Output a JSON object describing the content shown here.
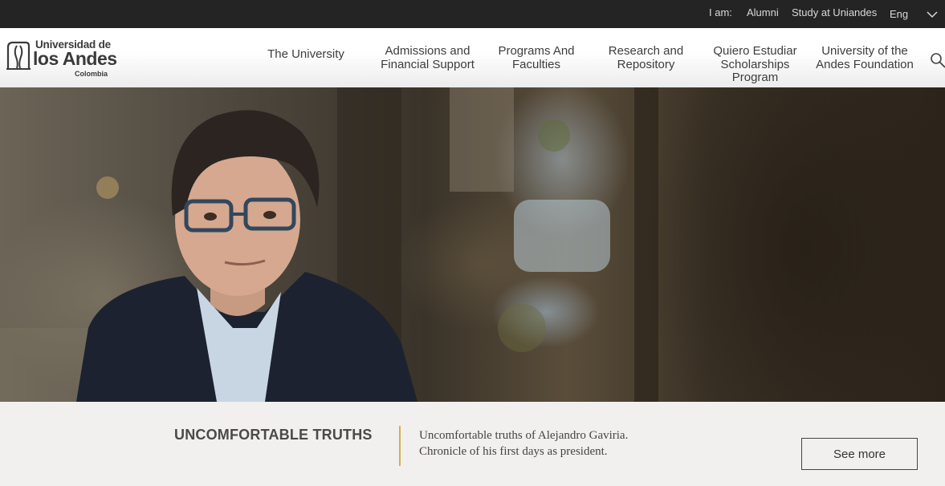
{
  "topbar": {
    "i_am_label": "I am:",
    "links": [
      "Alumni",
      "Study at Uniandes"
    ],
    "language": "Eng",
    "language_icon": "chevron-down-icon"
  },
  "logo": {
    "line1": "Universidad de",
    "line2": "los Andes",
    "line3": "Colombia"
  },
  "nav": {
    "items": [
      "The University",
      "Admissions and Financial Support",
      "Programs And Faculties",
      "Research and Repository",
      "Quiero Estudiar Scholarships Program",
      "University of the Andes Foundation"
    ],
    "search_icon": "search-icon"
  },
  "hero": {
    "image": "portrait-photo"
  },
  "feature": {
    "title": "UNCOMFORTABLE TRUTHS",
    "description_line1": "Uncomfortable truths of Alejandro Gaviria.",
    "description_line2": "Chronicle of his first days as president.",
    "button_label": "See more",
    "accent_color": "#d8b04a"
  }
}
